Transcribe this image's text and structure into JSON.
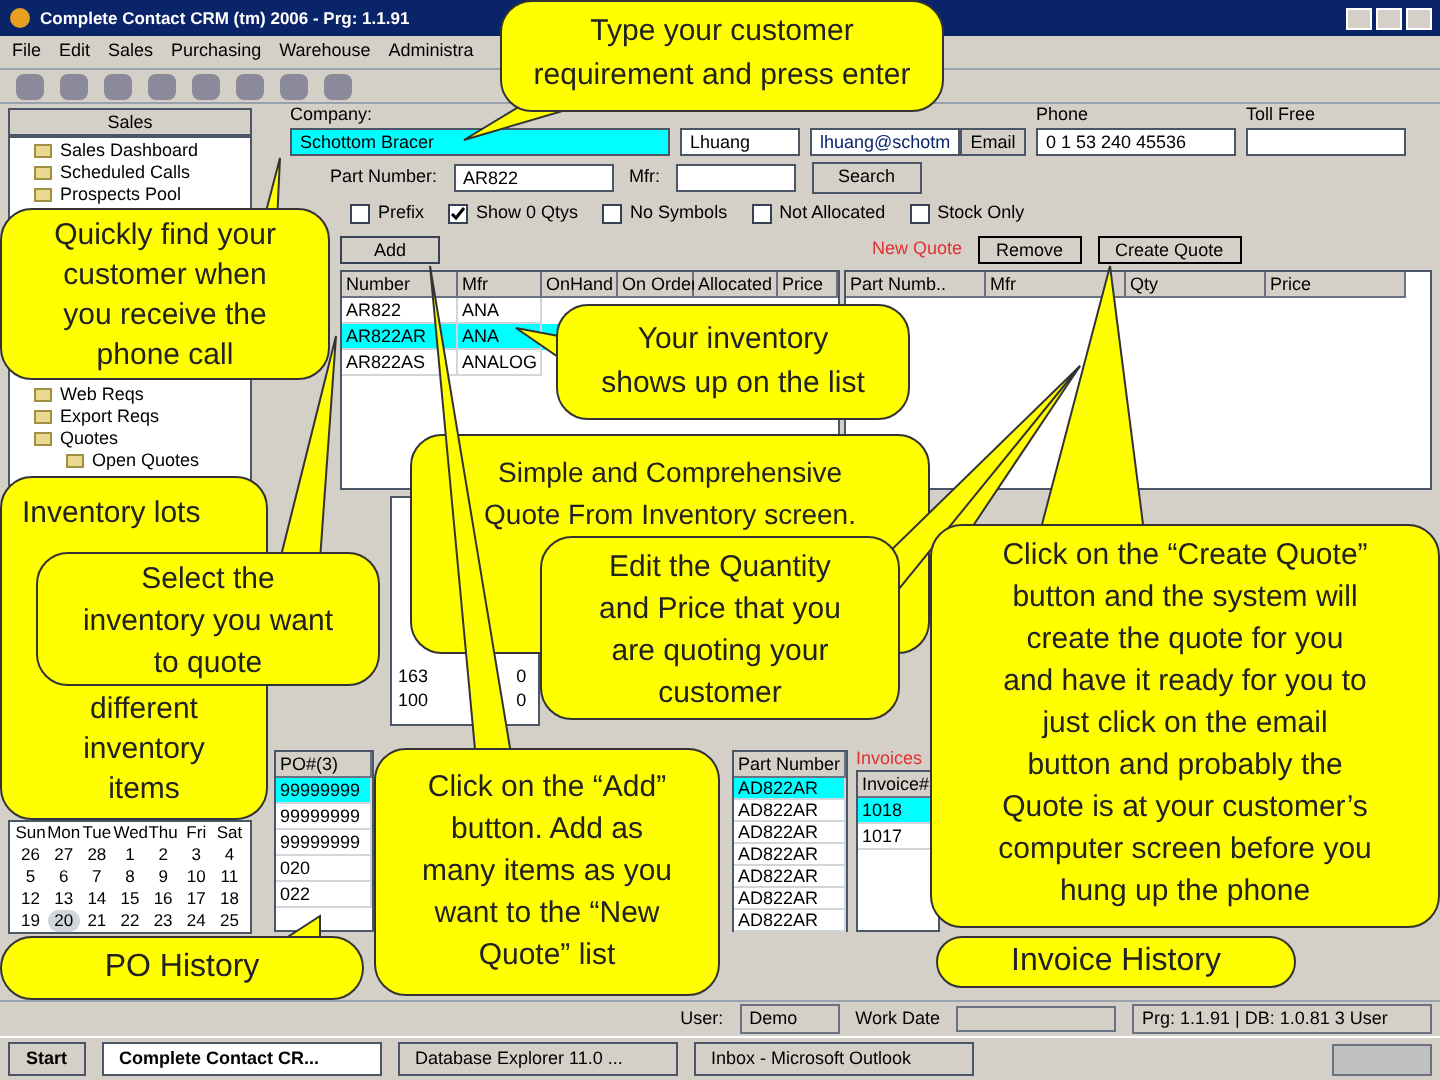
{
  "window": {
    "title": "Complete Contact CRM (tm) 2006 - Prg: 1.1.91"
  },
  "menu": [
    "File",
    "Edit",
    "Sales",
    "Purchasing",
    "Warehouse",
    "Administra"
  ],
  "sidebar": {
    "title": "Sales",
    "items": [
      {
        "label": "Sales Dashboard"
      },
      {
        "label": "Scheduled Calls"
      },
      {
        "label": "Prospects Pool"
      },
      {
        "label": "Web Reqs"
      },
      {
        "label": "Export Reqs"
      },
      {
        "label": "Quotes",
        "children": [
          {
            "label": "Open Quotes"
          }
        ]
      }
    ]
  },
  "customer": {
    "company_label": "Company:",
    "company": "Schottom Bracer",
    "contact": "Lhuang",
    "email": "lhuang@schotm",
    "email_button": "Email",
    "phone_label": "Phone",
    "phone": "0 1 53 240 45536",
    "tollfree_label": "Toll Free"
  },
  "search": {
    "part_label": "Part Number:",
    "part_number": "AR822",
    "mfr_label": "Mfr:",
    "button": "Search"
  },
  "filters": [
    {
      "label": "Prefix",
      "checked": false
    },
    {
      "label": "Show 0 Qtys",
      "checked": true
    },
    {
      "label": "No Symbols",
      "checked": false
    },
    {
      "label": "Not Allocated",
      "checked": false
    },
    {
      "label": "Stock Only",
      "checked": false
    }
  ],
  "inventory": {
    "add_button": "Add",
    "columns": [
      "Number",
      "Mfr",
      "OnHand",
      "On Order",
      "Allocated",
      "Price"
    ],
    "rows": [
      {
        "cells": [
          "AR822",
          "ANA"
        ],
        "selected": false
      },
      {
        "cells": [
          "AR822AR",
          "ANA"
        ],
        "selected": true
      },
      {
        "cells": [
          "AR822AS",
          "ANALOG"
        ],
        "selected": false
      }
    ]
  },
  "new_quote": {
    "label": "New Quote",
    "remove_button": "Remove",
    "create_button": "Create Quote",
    "columns": [
      "Part Numb..",
      "Mfr",
      "Qty",
      "Price"
    ]
  },
  "lots": {
    "rows": [
      {
        "cells": [
          "163",
          "0"
        ]
      },
      {
        "cells": [
          "100",
          "0"
        ]
      }
    ]
  },
  "po": {
    "column": "PO#(3)",
    "rows": [
      {
        "value": "99999999",
        "selected": true
      },
      {
        "value": "99999999",
        "selected": false
      },
      {
        "value": "99999999",
        "selected": false
      },
      {
        "value": "020",
        "selected": false
      },
      {
        "value": "022",
        "selected": false
      }
    ]
  },
  "calendar": {
    "weekdays": [
      "Sun",
      "Mon",
      "Tue",
      "Wed",
      "Thu",
      "Fri",
      "Sat"
    ],
    "days": [
      {
        "label": "26",
        "selected": false
      },
      {
        "label": "27",
        "selected": false
      },
      {
        "label": "28",
        "selected": false
      },
      {
        "label": "1",
        "selected": false
      },
      {
        "label": "2",
        "selected": false
      },
      {
        "label": "3",
        "selected": false
      },
      {
        "label": "4",
        "selected": false
      },
      {
        "label": "5",
        "selected": false
      },
      {
        "label": "6",
        "selected": false
      },
      {
        "label": "7",
        "selected": false
      },
      {
        "label": "8",
        "selected": false
      },
      {
        "label": "9",
        "selected": false
      },
      {
        "label": "10",
        "selected": false
      },
      {
        "label": "11",
        "selected": false
      },
      {
        "label": "12",
        "selected": false
      },
      {
        "label": "13",
        "selected": false
      },
      {
        "label": "14",
        "selected": false
      },
      {
        "label": "15",
        "selected": false
      },
      {
        "label": "16",
        "selected": false
      },
      {
        "label": "17",
        "selected": false
      },
      {
        "label": "18",
        "selected": false
      },
      {
        "label": "19",
        "selected": false
      },
      {
        "label": "20",
        "selected": true
      },
      {
        "label": "21",
        "selected": false
      },
      {
        "label": "22",
        "selected": false
      },
      {
        "label": "23",
        "selected": false
      },
      {
        "label": "24",
        "selected": false
      },
      {
        "label": "25",
        "selected": false
      }
    ]
  },
  "parts": {
    "column": "Part Number",
    "rows": [
      {
        "value": "AD822AR",
        "selected": true
      },
      {
        "value": "AD822AR",
        "selected": false
      },
      {
        "value": "AD822AR",
        "selected": false
      },
      {
        "value": "AD822AR",
        "selected": false
      },
      {
        "value": "AD822AR",
        "selected": false
      },
      {
        "value": "AD822AR",
        "selected": false
      },
      {
        "value": "AD822AR",
        "selected": false
      }
    ]
  },
  "invoices": {
    "title": "Invoices",
    "column": "Invoice#",
    "rows": [
      {
        "value": "1018",
        "selected": true
      },
      {
        "value": "1017",
        "selected": false
      }
    ]
  },
  "status_bar": {
    "user_label": "User:",
    "user": "Demo",
    "workdate_label": "Work Date",
    "info": "Prg: 1.1.91 | DB: 1.0.81 3 User"
  },
  "taskbar": {
    "start": "Start",
    "tasks": [
      "Complete Contact CR...",
      "Database Explorer 11.0 ...",
      "Inbox - Microsoft Outlook"
    ]
  },
  "callouts": [
    {
      "lines": [
        "Type your customer",
        "requirement and press enter"
      ]
    },
    {
      "lines": [
        "Quickly find your",
        "customer when",
        "you receive the",
        "phone call"
      ]
    },
    {
      "lines": [
        "Your inventory",
        "shows up on the list"
      ]
    },
    {
      "lines": [
        "Simple and Comprehensive",
        "Quote From Inventory screen."
      ]
    },
    {
      "lines": [
        "Inventory lots"
      ],
      "lines_bottom": [
        "different",
        "inventory",
        "items"
      ]
    },
    {
      "lines": [
        "Edit the Quantity",
        "and Price that you",
        "are quoting your",
        "customer"
      ]
    },
    {
      "lines": [
        "Click on the “Create Quote”",
        "button and the system will",
        "create the quote for you",
        "and have it ready for you to",
        "just click on the email",
        "button and probably the",
        "Quote is at your customer’s",
        "computer screen before you",
        "hung up the phone"
      ]
    },
    {
      "lines": [
        "Select the",
        "inventory you want",
        "to quote"
      ]
    },
    {
      "lines": [
        "Click on the “Add”",
        "button. Add as",
        "many items as you",
        "want to the “New",
        "Quote” list"
      ]
    },
    {
      "lines": [
        "PO History"
      ]
    },
    {
      "lines": [
        "Invoice History"
      ]
    }
  ]
}
